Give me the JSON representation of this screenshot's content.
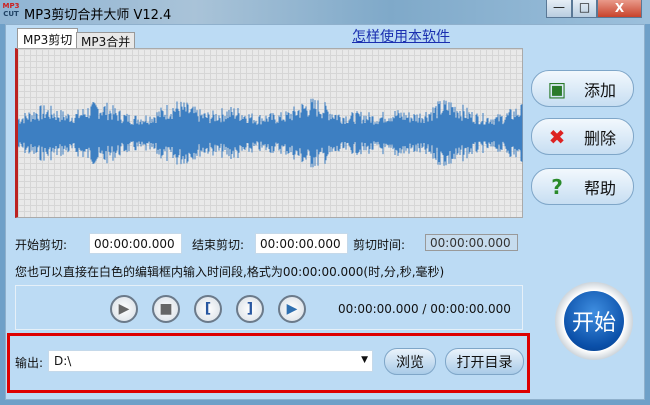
{
  "window": {
    "title": "MP3剪切合并大师 V12.4",
    "logo_top": "MP3",
    "logo_bottom": "CUT",
    "minimize": "—",
    "maximize": "□",
    "close": "X"
  },
  "tabs": [
    {
      "label": "MP3剪切",
      "active": true
    },
    {
      "label": "MP3合并",
      "active": false
    }
  ],
  "help_link": "怎样使用本软件",
  "waveform": {
    "color": "#3d7fc2"
  },
  "side_buttons": [
    {
      "label": "添加",
      "icon": "film-add-icon"
    },
    {
      "label": "删除",
      "icon": "red-x-icon"
    },
    {
      "label": "帮助",
      "icon": "help-icon"
    }
  ],
  "times": {
    "start_label": "开始剪切:",
    "start_value": "00:00:00.000",
    "end_label": "结束剪切:",
    "end_value": "00:00:00.000",
    "duration_label": "剪切时间:",
    "duration_value": "00:00:00.000"
  },
  "hint": "您也可以直接在白色的编辑框内输入时间段,格式为00:00:00.000(时,分,秒,毫秒)",
  "player": {
    "position": "00:00:00.000 / 00:00:00.000",
    "buttons": [
      "play",
      "stop",
      "mark-start",
      "mark-end",
      "play-selection"
    ],
    "mark_start": "[",
    "mark_end": "]"
  },
  "output": {
    "label": "输出:",
    "value": "D:\\",
    "browse": "浏览",
    "open_dir": "打开目录"
  },
  "start_button": "开始",
  "colors": {
    "highlight_box": "#dd0000",
    "start_button": "#0a4fa8"
  }
}
